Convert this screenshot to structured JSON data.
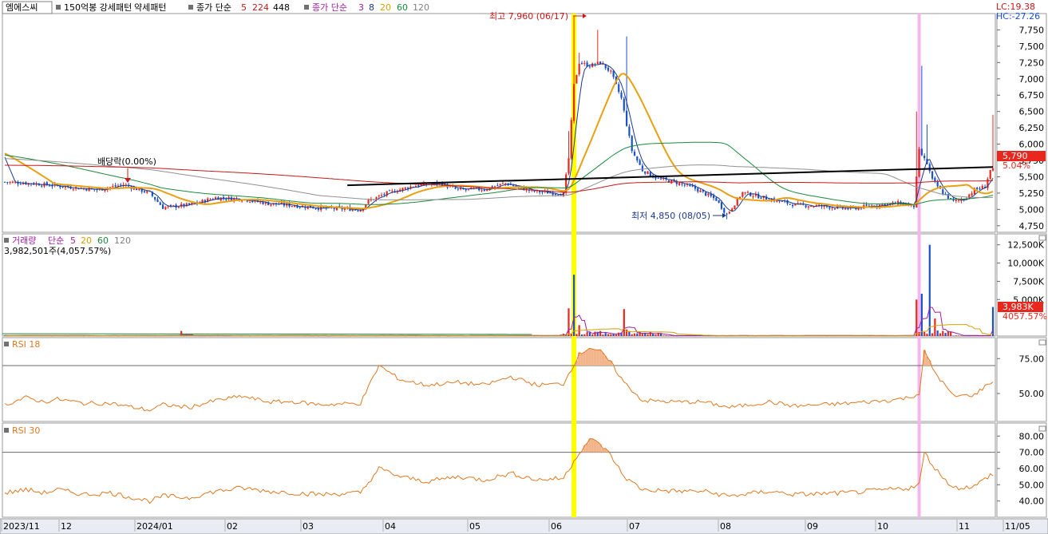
{
  "header": {
    "symbol": "엠에스씨",
    "tags": [
      "150억봉 강세패턴",
      "약세패턴"
    ],
    "ma_price_label": "종가 단순",
    "ma_price_periods": [
      "5",
      "224",
      "448"
    ],
    "ma_price2_label": "종가 단순",
    "ma_price2_periods": [
      "3",
      "8",
      "20",
      "60",
      "120"
    ],
    "lc": "LC:19.38",
    "hc": "HC:-27.26"
  },
  "annotations": {
    "high": "최고 7,960 (06/17)",
    "low": "최저 4,850 (08/05)",
    "dividend": "배당락(0.00%)"
  },
  "volume_header": {
    "label": "거래량",
    "ma_label": "단순",
    "periods": [
      "5",
      "20",
      "60",
      "120"
    ],
    "current": "3,982,501주(4,057.57%)"
  },
  "rsi1": {
    "label": "RSI 18"
  },
  "rsi2": {
    "label": "RSI 30"
  },
  "price_tags": {
    "last": "5,790",
    "pct": "5.04%"
  },
  "volume_tags": {
    "last": "3,983K",
    "pct": "4057.57%"
  },
  "colors": {
    "up": "#e8281e",
    "down": "#1a50c8",
    "highlight_yellow": "#ffff00",
    "highlight_pink": "#f3b7ee",
    "rsi": "#e07820",
    "ma_orange": "#e8a010",
    "ma_red": "#c81818",
    "ma_gray": "#909090",
    "ma_green": "#1a8a3a",
    "trendline": "#000000"
  },
  "chart_data": [
    {
      "type": "candlestick",
      "panel": "price",
      "ylim": [
        4650,
        8000
      ],
      "y_ticks": [
        4750,
        5000,
        5250,
        5500,
        5750,
        6000,
        6250,
        6500,
        6750,
        7000,
        7250,
        7500,
        7750
      ],
      "y_tick_labels": [
        "4,750",
        "5,000",
        "5,250",
        "5,500",
        "5,750",
        "6,000",
        "6,250",
        "6,500",
        "6,750",
        "7,000",
        "7,250",
        "7,500",
        "7,750"
      ],
      "x_labels": [
        "2023/11",
        "12",
        "2024/01",
        "02",
        "03",
        "04",
        "05",
        "06",
        "07",
        "08",
        "09",
        "10",
        "11",
        "11/05"
      ],
      "keypoints": [
        [
          0,
          5420
        ],
        [
          10,
          5400
        ],
        [
          25,
          5340
        ],
        [
          35,
          5300
        ],
        [
          45,
          5380
        ],
        [
          55,
          5250
        ],
        [
          60,
          5030
        ],
        [
          70,
          5070
        ],
        [
          80,
          5180
        ],
        [
          90,
          5160
        ],
        [
          100,
          5090
        ],
        [
          110,
          5060
        ],
        [
          120,
          5020
        ],
        [
          135,
          5000
        ],
        [
          138,
          5130
        ],
        [
          145,
          5250
        ],
        [
          155,
          5360
        ],
        [
          165,
          5400
        ],
        [
          172,
          5300
        ],
        [
          182,
          5310
        ],
        [
          190,
          5400
        ],
        [
          200,
          5280
        ],
        [
          212,
          5240
        ],
        [
          214,
          5780
        ],
        [
          216,
          6900
        ],
        [
          218,
          7250
        ],
        [
          222,
          7200
        ],
        [
          226,
          7250
        ],
        [
          230,
          7100
        ],
        [
          234,
          6700
        ],
        [
          238,
          5900
        ],
        [
          242,
          5600
        ],
        [
          248,
          5470
        ],
        [
          255,
          5410
        ],
        [
          262,
          5320
        ],
        [
          270,
          5150
        ],
        [
          274,
          4920
        ],
        [
          280,
          5260
        ],
        [
          290,
          5160
        ],
        [
          300,
          5070
        ],
        [
          310,
          5050
        ],
        [
          320,
          5010
        ],
        [
          330,
          5060
        ],
        [
          340,
          5100
        ],
        [
          345,
          5050
        ],
        [
          347,
          5900
        ],
        [
          350,
          5700
        ],
        [
          352,
          5450
        ],
        [
          356,
          5250
        ],
        [
          360,
          5120
        ],
        [
          364,
          5160
        ],
        [
          368,
          5300
        ],
        [
          372,
          5350
        ],
        [
          374,
          5600
        ]
      ],
      "spikes": [
        [
          214,
          6200
        ],
        [
          216,
          7960
        ],
        [
          218,
          7400
        ],
        [
          225,
          7750
        ],
        [
          236,
          7650
        ],
        [
          274,
          4850
        ],
        [
          346,
          6500
        ],
        [
          348,
          7200
        ],
        [
          350,
          6300
        ],
        [
          375,
          6450
        ]
      ],
      "moving_averages": [
        {
          "period": "5",
          "color": "#1a3a8a"
        },
        {
          "period": "20",
          "color": "#e8a010"
        },
        {
          "period": "60",
          "color": "#1a8a3a"
        },
        {
          "period": "120",
          "color": "#909090"
        },
        {
          "period": "224",
          "color": "#c81818"
        }
      ],
      "trendline": {
        "from": [
          130,
          5370
        ],
        "to": [
          375,
          5650
        ]
      }
    },
    {
      "type": "bar",
      "panel": "volume",
      "ylim": [
        0,
        14000
      ],
      "y_ticks": [
        5000,
        7500,
        10000,
        12500
      ],
      "y_tick_labels": [
        "5,000K",
        "7,500K",
        "10,000K",
        "12,500K"
      ],
      "spikes": [
        [
          67,
          700
        ],
        [
          214,
          3800
        ],
        [
          216,
          8400
        ],
        [
          218,
          1500
        ],
        [
          222,
          500
        ],
        [
          226,
          700
        ],
        [
          235,
          3700
        ],
        [
          236,
          900
        ],
        [
          346,
          5000
        ],
        [
          348,
          5800
        ],
        [
          351,
          12500
        ],
        [
          353,
          2400
        ],
        [
          375,
          3983
        ]
      ]
    },
    {
      "type": "line",
      "panel": "rsi1",
      "name": "RSI 18",
      "ylim": [
        30,
        90
      ],
      "y_ticks": [
        50,
        75
      ],
      "y_tick_labels": [
        "50.00",
        "75.00"
      ],
      "guides": [
        70
      ],
      "keypoints": [
        [
          0,
          42
        ],
        [
          8,
          47
        ],
        [
          15,
          44
        ],
        [
          20,
          46
        ],
        [
          30,
          43
        ],
        [
          40,
          43
        ],
        [
          55,
          38
        ],
        [
          60,
          42
        ],
        [
          70,
          40
        ],
        [
          80,
          45
        ],
        [
          90,
          48
        ],
        [
          100,
          44
        ],
        [
          110,
          44
        ],
        [
          120,
          42
        ],
        [
          135,
          43
        ],
        [
          142,
          70
        ],
        [
          150,
          60
        ],
        [
          160,
          56
        ],
        [
          172,
          58
        ],
        [
          182,
          56
        ],
        [
          192,
          62
        ],
        [
          202,
          56
        ],
        [
          212,
          57
        ],
        [
          218,
          78
        ],
        [
          222,
          83
        ],
        [
          226,
          80
        ],
        [
          230,
          72
        ],
        [
          235,
          58
        ],
        [
          242,
          45
        ],
        [
          255,
          44
        ],
        [
          265,
          44
        ],
        [
          275,
          40
        ],
        [
          290,
          44
        ],
        [
          300,
          41
        ],
        [
          320,
          43
        ],
        [
          335,
          45
        ],
        [
          343,
          47
        ],
        [
          347,
          50
        ],
        [
          349,
          80
        ],
        [
          353,
          65
        ],
        [
          360,
          48
        ],
        [
          368,
          49
        ],
        [
          374,
          58
        ]
      ]
    },
    {
      "type": "line",
      "panel": "rsi2",
      "name": "RSI 30",
      "ylim": [
        30,
        88
      ],
      "y_ticks": [
        40,
        50,
        60,
        70,
        80
      ],
      "y_tick_labels": [
        "40.00",
        "50.00",
        "60.00",
        "70.00",
        "80.00"
      ],
      "guides": [
        70
      ],
      "keypoints": [
        [
          0,
          45
        ],
        [
          8,
          47
        ],
        [
          15,
          45
        ],
        [
          20,
          47
        ],
        [
          30,
          44
        ],
        [
          40,
          45
        ],
        [
          55,
          40
        ],
        [
          60,
          43
        ],
        [
          70,
          42
        ],
        [
          80,
          46
        ],
        [
          90,
          48
        ],
        [
          100,
          46
        ],
        [
          110,
          45
        ],
        [
          120,
          44
        ],
        [
          135,
          45
        ],
        [
          142,
          60
        ],
        [
          150,
          55
        ],
        [
          160,
          52
        ],
        [
          172,
          55
        ],
        [
          182,
          53
        ],
        [
          192,
          57
        ],
        [
          202,
          53
        ],
        [
          212,
          54
        ],
        [
          218,
          70
        ],
        [
          222,
          78
        ],
        [
          226,
          75
        ],
        [
          230,
          68
        ],
        [
          235,
          55
        ],
        [
          242,
          47
        ],
        [
          255,
          46
        ],
        [
          265,
          46
        ],
        [
          275,
          43
        ],
        [
          290,
          46
        ],
        [
          300,
          44
        ],
        [
          320,
          45
        ],
        [
          335,
          47
        ],
        [
          343,
          48
        ],
        [
          347,
          50
        ],
        [
          349,
          70
        ],
        [
          353,
          60
        ],
        [
          360,
          48
        ],
        [
          368,
          49
        ],
        [
          374,
          56
        ]
      ]
    }
  ]
}
